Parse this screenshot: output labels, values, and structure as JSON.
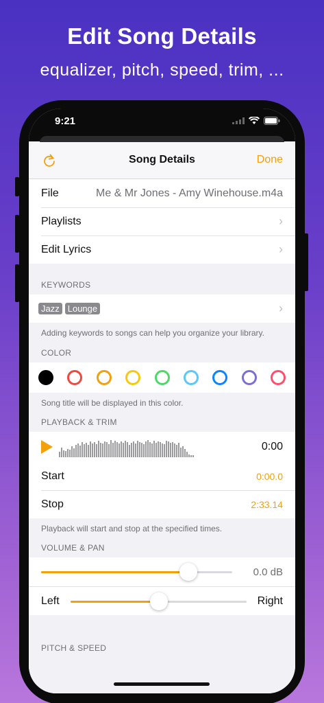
{
  "hero": {
    "title": "Edit Song Details",
    "subtitle": "equalizer, pitch, speed, trim, ..."
  },
  "status": {
    "time": "9:21"
  },
  "nav": {
    "title": "Song Details",
    "done_label": "Done",
    "refresh_icon": "refresh-icon"
  },
  "info": {
    "file_label": "File",
    "file_value": "Me & Mr Jones - Amy Winehouse.m4a",
    "playlists_label": "Playlists",
    "lyrics_label": "Edit Lyrics"
  },
  "keywords": {
    "header": "KEYWORDS",
    "tags": [
      "Jazz",
      "Lounge"
    ],
    "footer": "Adding keywords to songs can help you organize your library."
  },
  "color": {
    "header": "COLOR",
    "options": [
      "#000000",
      "#f0493b",
      "#f2a00c",
      "#f5c90f",
      "#4cd964",
      "#5ac8fa",
      "#0a84ff",
      "#7a6fd6",
      "#ff4f6a"
    ],
    "selected": 0,
    "footer": "Song title will be displayed in this color."
  },
  "playback": {
    "header": "PLAYBACK & TRIM",
    "position": "0:00",
    "start_label": "Start",
    "start_value": "0:00.0",
    "stop_label": "Stop",
    "stop_value": "2:33.14",
    "footer": "Playback will start and stop at the specified times."
  },
  "volume": {
    "header": "VOLUME & PAN",
    "volume_value": "0.0 dB",
    "volume_level": 0.77,
    "pan_left": "Left",
    "pan_right": "Right",
    "pan_level": 0.5
  },
  "pitch": {
    "header": "PITCH & SPEED"
  },
  "colors": {
    "accent": "#f2a00c"
  }
}
